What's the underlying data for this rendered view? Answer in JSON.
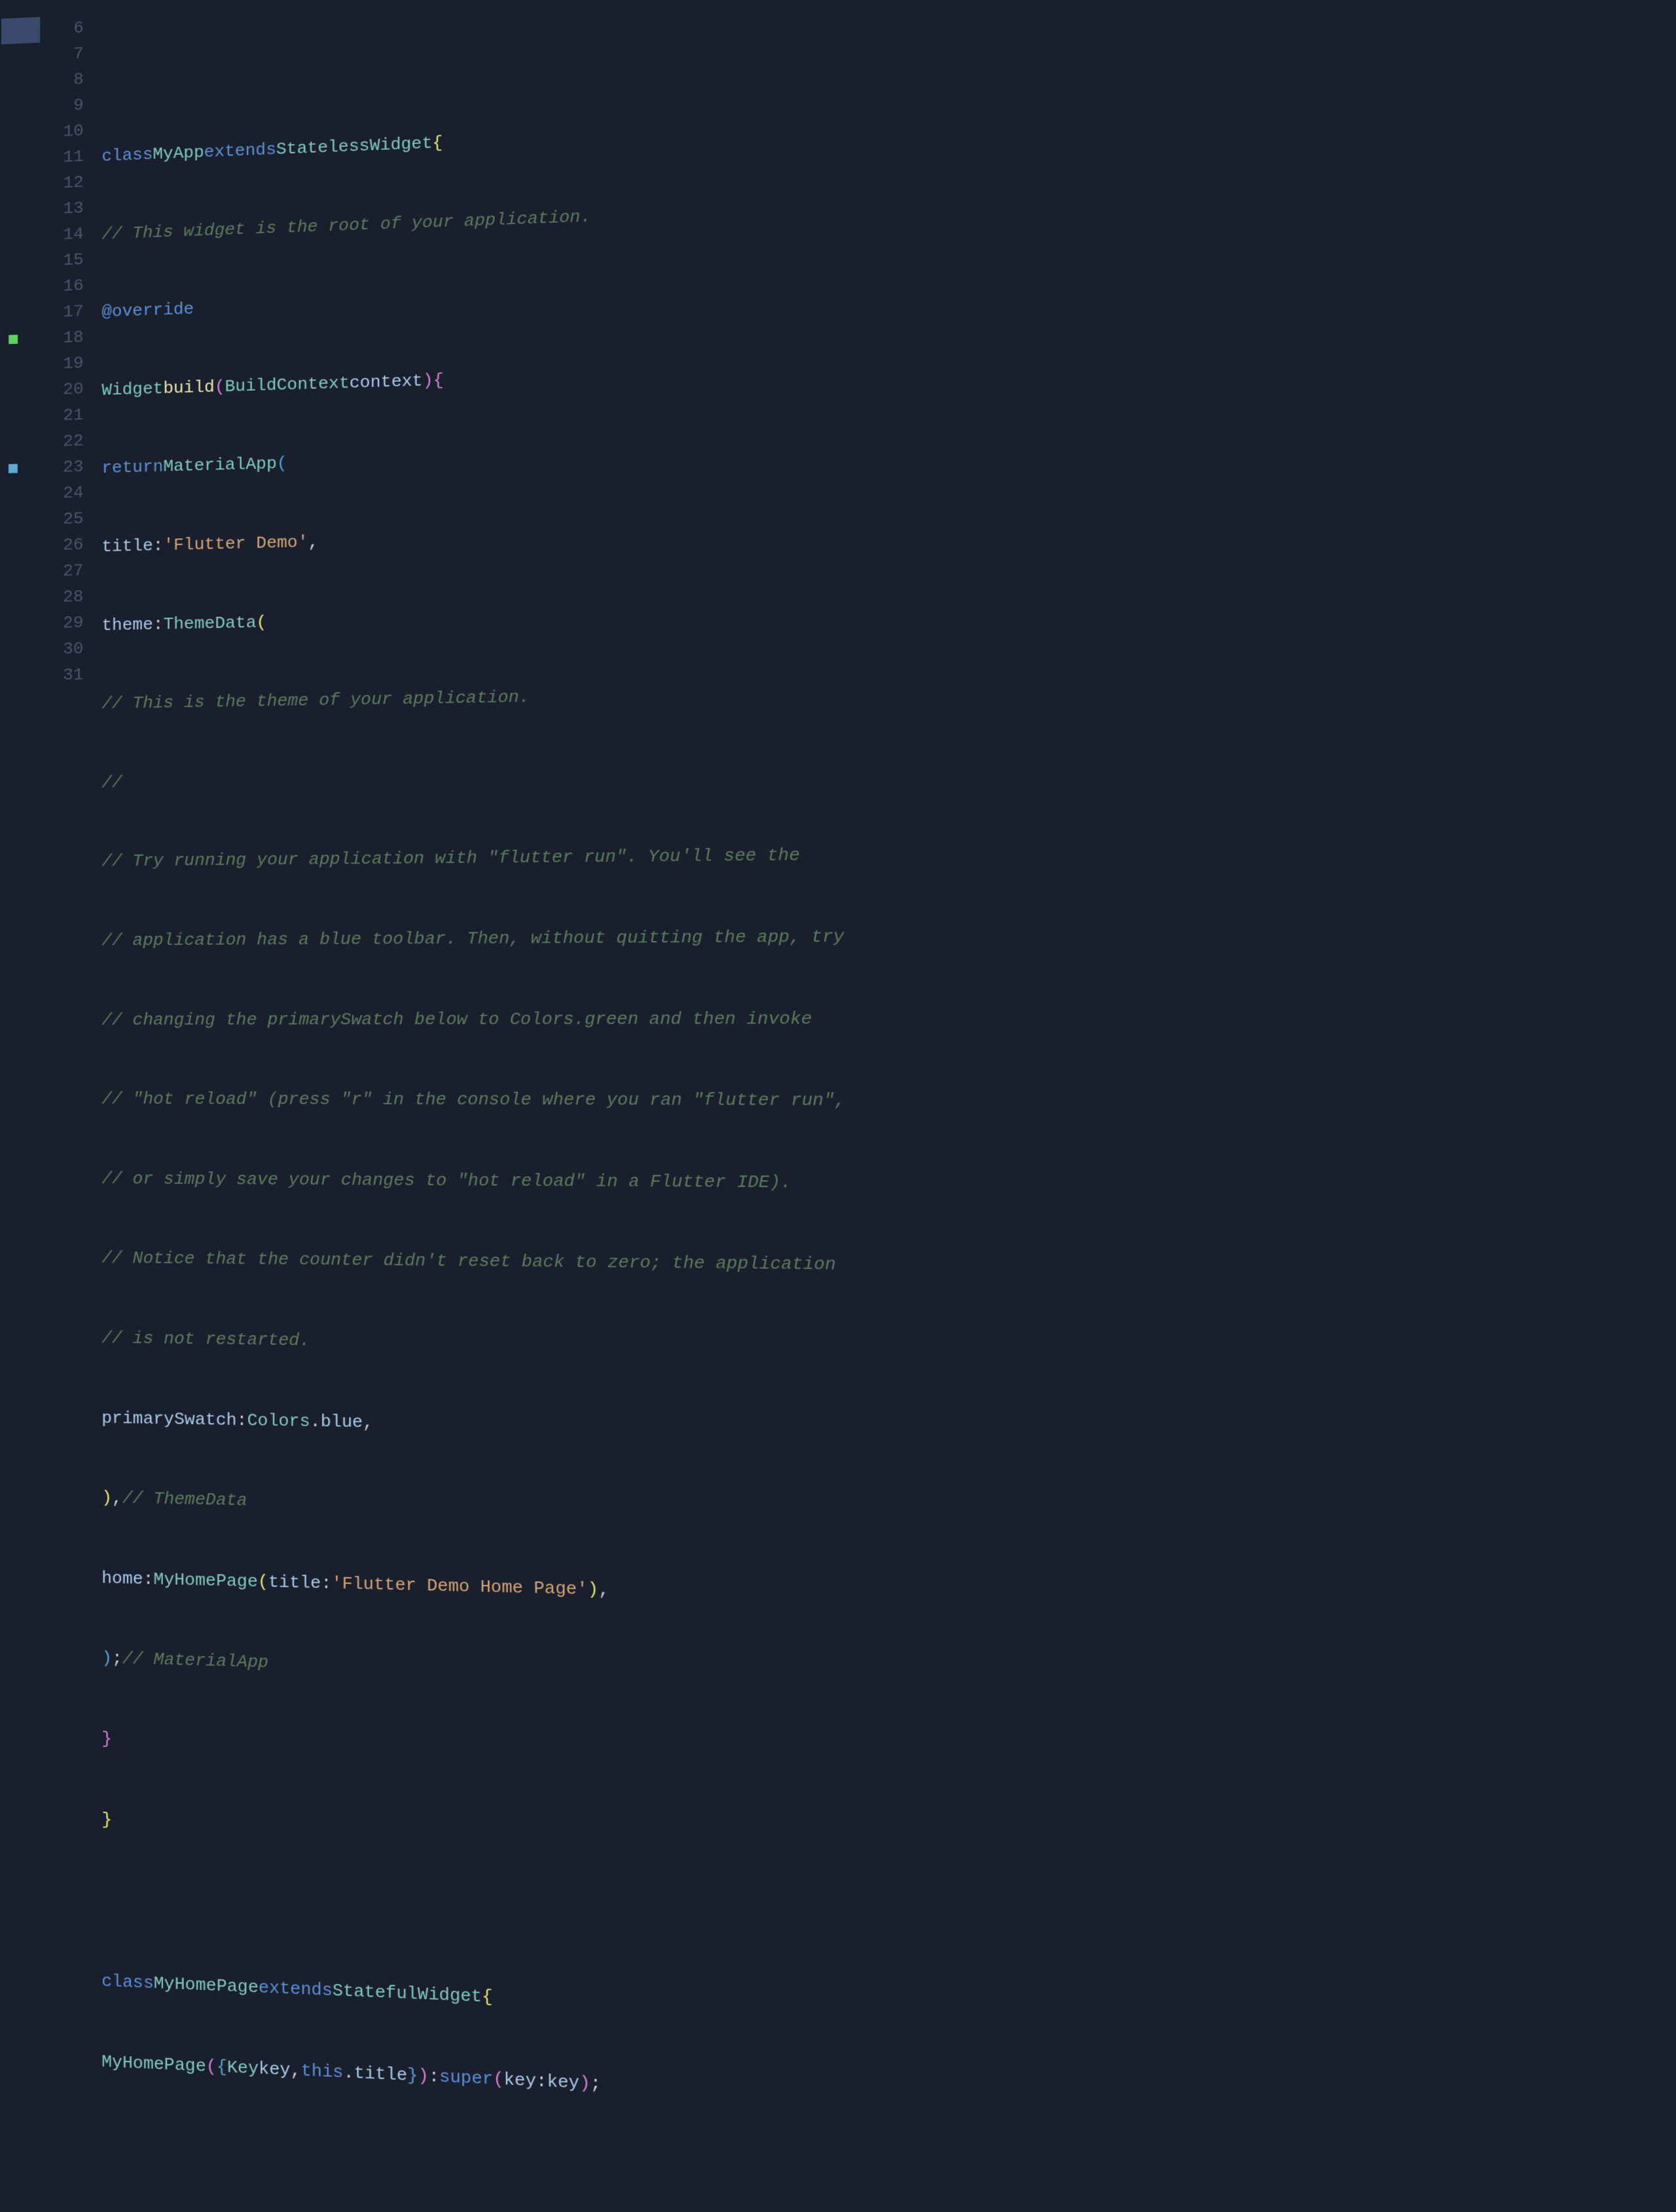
{
  "lines": {
    "6": {
      "num": "6",
      "content": ""
    },
    "7": {
      "num": "7",
      "content": "class MyApp extends StatelessWidget {"
    },
    "8": {
      "num": "8",
      "content": "  // This widget is the root of your application."
    },
    "9": {
      "num": "9",
      "content": "  @override"
    },
    "10": {
      "num": "10",
      "content": "  Widget build(BuildContext context) {"
    },
    "11": {
      "num": "11",
      "content": "    return MaterialApp("
    },
    "12": {
      "num": "12",
      "content": "      title: 'Flutter Demo',"
    },
    "13": {
      "num": "13",
      "content": "      theme: ThemeData("
    },
    "14": {
      "num": "14",
      "content": "        // This is the theme of your application."
    },
    "15": {
      "num": "15",
      "content": "        //"
    },
    "16": {
      "num": "16",
      "content": "        // Try running your application with \"flutter run\". You'll see the"
    },
    "17": {
      "num": "17",
      "content": "        // application has a blue toolbar. Then, without quitting the app, try"
    },
    "18": {
      "num": "18",
      "content": "        // changing the primarySwatch below to Colors.green and then invoke"
    },
    "19": {
      "num": "19",
      "content": "        // \"hot reload\" (press \"r\" in the console where you ran \"flutter run\","
    },
    "20": {
      "num": "20",
      "content": "        // or simply save your changes to \"hot reload\" in a Flutter IDE)."
    },
    "21": {
      "num": "21",
      "content": "        // Notice that the counter didn't reset back to zero; the application"
    },
    "22": {
      "num": "22",
      "content": "        // is not restarted."
    },
    "23": {
      "num": "23",
      "content": "        primarySwatch: Colors.blue,"
    },
    "24": {
      "num": "24",
      "content": "      ), // ThemeData"
    },
    "25": {
      "num": "25",
      "content": "      home: MyHomePage(title: 'Flutter Demo Home Page'),"
    },
    "26": {
      "num": "26",
      "content": "    ); // MaterialApp"
    },
    "27": {
      "num": "27",
      "content": "  }"
    },
    "28": {
      "num": "28",
      "content": "}"
    },
    "29": {
      "num": "29",
      "content": ""
    },
    "30": {
      "num": "30",
      "content": "class MyHomePage extends StatefulWidget {"
    },
    "31": {
      "num": "31",
      "content": "  MyHomePage({Key key, this.title}) : super(key: key);"
    }
  },
  "tokens": {
    "class_kw": "class",
    "extends_kw": "extends",
    "return_kw": "return",
    "this_kw": "this",
    "super_kw": "super",
    "MyApp": "MyApp",
    "StatelessWidget": "StatelessWidget",
    "StatefulWidget": "StatefulWidget",
    "Widget": "Widget",
    "BuildContext": "BuildContext",
    "MaterialApp": "MaterialApp",
    "ThemeData": "ThemeData",
    "Colors": "Colors",
    "MyHomePage": "MyHomePage",
    "Key": "Key",
    "override": "@override",
    "build": "build",
    "context": "context",
    "title": "title",
    "theme": "theme",
    "primarySwatch": "primarySwatch",
    "blue": "blue",
    "home": "home",
    "key": "key",
    "flutter_demo": "'Flutter Demo'",
    "flutter_demo_home": "'Flutter Demo Home Page'",
    "comment_root": "// This widget is the root of your application.",
    "comment_theme": "// This is the theme of your application.",
    "comment_blank": "//",
    "comment_try": "// Try running your application with \"flutter run\". You'll see the",
    "comment_blue": "// application has a blue toolbar. Then, without quitting the app, try",
    "comment_changing": "// changing the primarySwatch below to Colors.green and then invoke",
    "comment_hot": "// \"hot reload\" (press \"r\" in the console where you ran \"flutter run\",",
    "comment_save": "// or simply save your changes to \"hot reload\" in a Flutter IDE).",
    "comment_notice": "// Notice that the counter didn't reset back to zero; the application",
    "comment_restart": "// is not restarted.",
    "hint_themedata": "// ThemeData",
    "hint_materialapp": "// MaterialApp"
  },
  "markers": {
    "18": "green",
    "23": "blue"
  }
}
